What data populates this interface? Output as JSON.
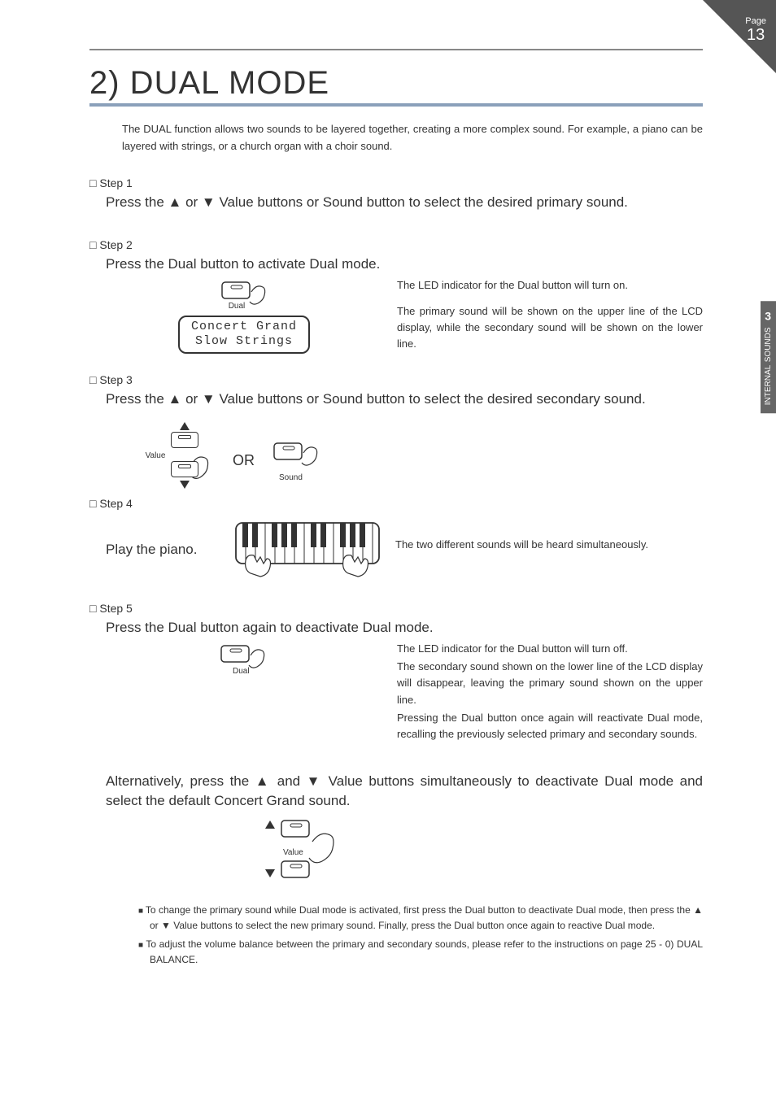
{
  "page": {
    "label": "Page",
    "number": "13"
  },
  "sideTab": {
    "line1": "INTERNAL",
    "line2": "SOUNDS",
    "chapter": "3"
  },
  "title": "2) DUAL MODE",
  "intro": "The DUAL function allows two sounds to be layered together, creating a more complex sound. For example, a piano can be layered with strings, or a church organ with a choir sound.",
  "steps": {
    "s1": {
      "head": "Step 1",
      "body": "Press the ▲ or ▼ Value buttons or Sound button to select the desired primary sound."
    },
    "s2": {
      "head": "Step 2",
      "body": "Press the Dual button to activate Dual mode.",
      "lcd": {
        "line1": "Concert Grand",
        "line2": "Slow Strings"
      },
      "btnLabel": "Dual",
      "desc1": "The LED indicator for the Dual button will turn on.",
      "desc2": "The primary sound will be shown on the upper line of the LCD display, while the secondary sound will be shown on the lower line."
    },
    "s3": {
      "head": "Step 3",
      "body": "Press the ▲ or ▼ Value buttons or Sound button to select the desired secondary sound.",
      "valueLabel": "Value",
      "or": "OR",
      "soundLabel": "Sound"
    },
    "s4": {
      "head": "Step 4",
      "body": "Play the piano.",
      "desc": "The two different sounds will be heard simultaneously."
    },
    "s5": {
      "head": "Step 5",
      "body": "Press the Dual button again to deactivate Dual mode.",
      "btnLabel": "Dual",
      "desc1": "The LED indicator for the Dual button will turn off.",
      "desc2": "The secondary sound shown on the lower line of the LCD display will disappear, leaving the primary sound shown on the upper line.",
      "desc3": "Pressing the Dual button once again will reactivate Dual mode, recalling the previously selected primary and secondary sounds."
    }
  },
  "alt": {
    "text": "Alternatively, press the ▲ and ▼ Value buttons simultaneously to deactivate Dual mode and select the default Concert Grand sound.",
    "valueLabel": "Value"
  },
  "notes": {
    "n1": "To change the primary sound while Dual mode is activated, first press the Dual button to deactivate Dual mode, then press the ▲ or ▼ Value buttons to select the new primary sound.  Finally, press the Dual button once again to reactive Dual mode.",
    "n2": "To adjust the volume balance between the primary and secondary sounds, please refer to the instructions on page 25 - 0) DUAL BALANCE."
  }
}
